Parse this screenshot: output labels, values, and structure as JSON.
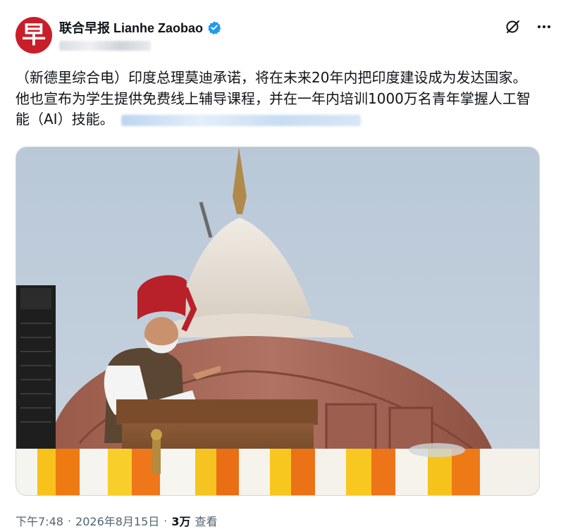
{
  "post": {
    "author": {
      "display_name": "联合早报 Lianhe Zaobao",
      "avatar_glyph": "早",
      "verified": true
    },
    "actions": {
      "grok_icon": "grok-icon",
      "more_icon": "more-icon"
    },
    "text": "（新德里综合电）印度总理莫迪承诺，将在未来20年内把印度建设成为发达国家。他也宣布为学生提供免费线上辅导课程，并在一年内培训1000万名青年掌握人工智能（AI）技能。",
    "timestamp": {
      "time": "下午7:48",
      "separator1": "·",
      "date": "2026年8月15日",
      "separator2": "·",
      "views_count": "3万",
      "views_label": "查看"
    }
  },
  "colors": {
    "brand": "#c81e2a",
    "verified": "#1d9bf0",
    "muted_text": "#536471"
  }
}
